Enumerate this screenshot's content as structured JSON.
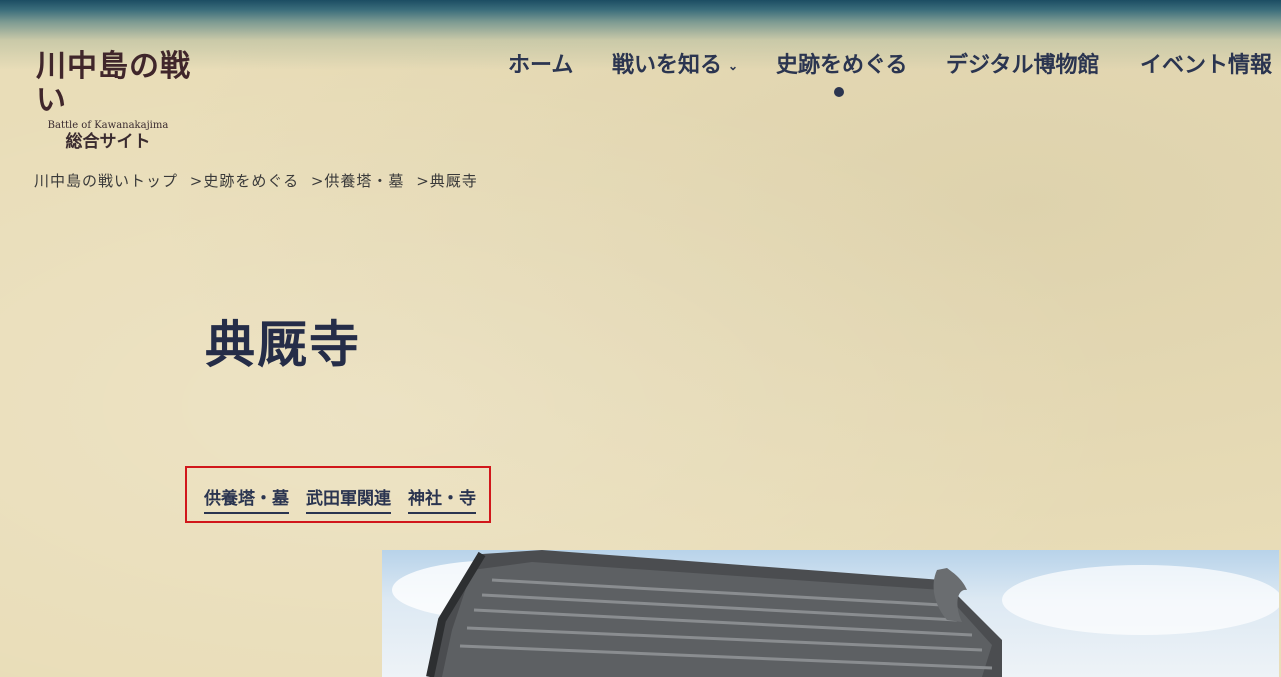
{
  "logo": {
    "title": "川中島の戦い",
    "subtitle": "Battle of Kawanakajima",
    "bottom": "総合サイト"
  },
  "nav": {
    "home": "ホーム",
    "battle": "戦いを知る",
    "sites": "史跡をめぐる",
    "museum": "デジタル博物館",
    "events": "イベント情報"
  },
  "breadcrumb": [
    "川中島の戦いトップ",
    ">史跡をめぐる",
    ">供養塔・墓",
    ">典厩寺"
  ],
  "page": {
    "title": "典厩寺"
  },
  "tags": [
    "供養塔・墓",
    "武田軍関連",
    "神社・寺"
  ],
  "colors": {
    "background": "#e9ddb8",
    "nav_text": "#2b3550",
    "highlight_border": "#d1171b"
  },
  "icons": {
    "chevron": "chevron-down-icon",
    "active_indicator": "active-dot"
  }
}
